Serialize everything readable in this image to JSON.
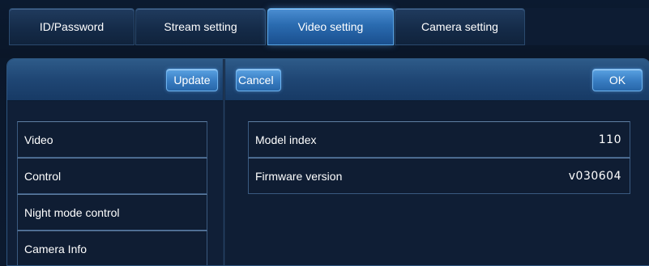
{
  "tabs": [
    {
      "label": "ID/Password",
      "active": false
    },
    {
      "label": "Stream setting",
      "active": false
    },
    {
      "label": "Video setting",
      "active": true
    },
    {
      "label": "Camera setting",
      "active": false
    }
  ],
  "toolbar": {
    "update_label": "Update",
    "cancel_label": "Cancel",
    "ok_label": "OK"
  },
  "menu": {
    "items": [
      {
        "label": "Video"
      },
      {
        "label": "Control"
      },
      {
        "label": "Night mode control"
      },
      {
        "label": "Camera Info"
      }
    ]
  },
  "camera_info": {
    "rows": [
      {
        "label": "Model index",
        "value": "110"
      },
      {
        "label": "Firmware version",
        "value": "v030604"
      }
    ]
  },
  "colors": {
    "background": "#0c1a2f",
    "accent": "#3a7fc4",
    "active_tab": "#2a6bb0",
    "border": "#3a5a80"
  }
}
